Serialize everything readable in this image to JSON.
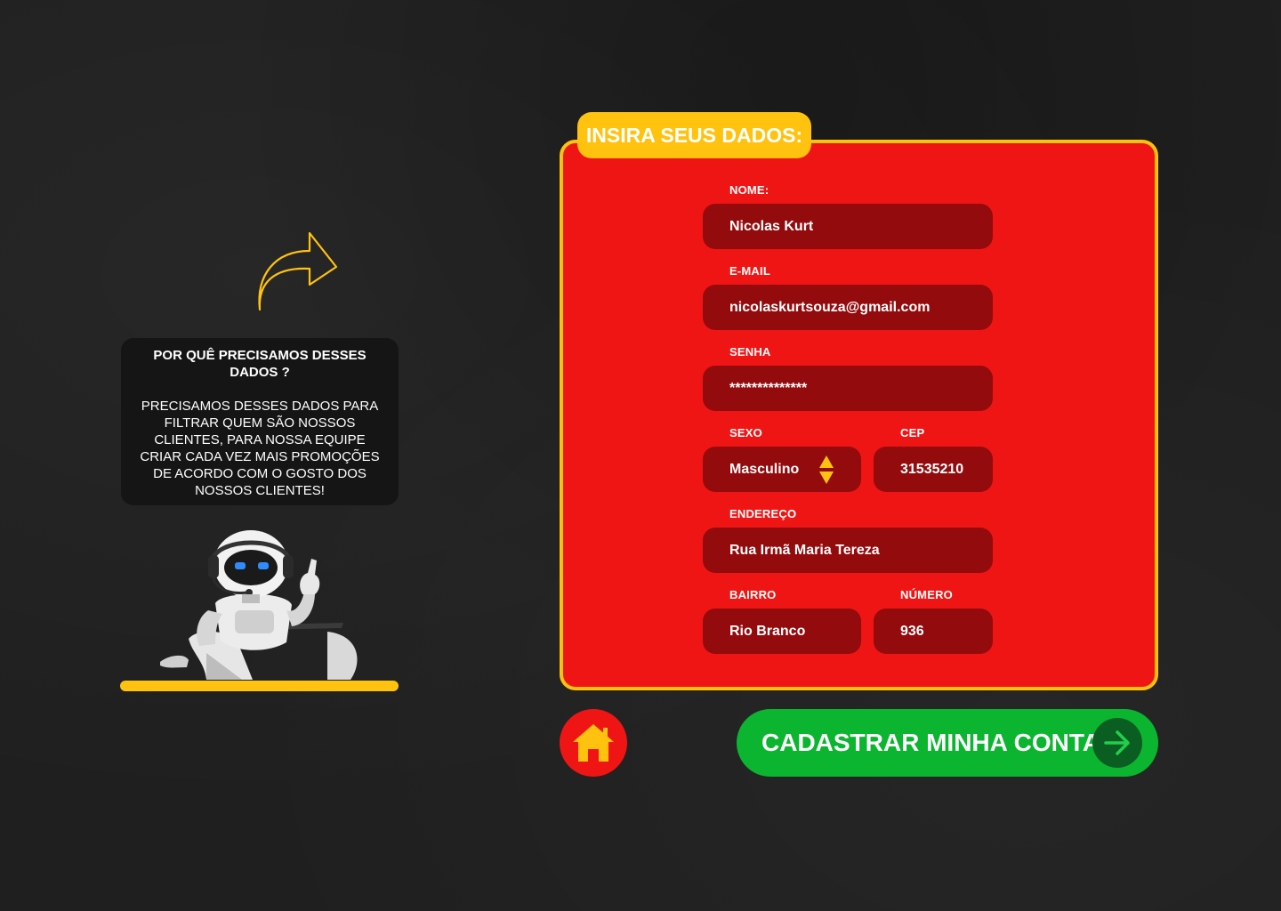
{
  "colors": {
    "background": "#1f1f1f",
    "panel_red": "#f01515",
    "field_dark_red": "#930b0d",
    "accent_yellow": "#ffc20e",
    "submit_green": "#0bb52f",
    "submit_arrow_bg": "#0b5e22"
  },
  "info": {
    "title": "POR QUÊ PRECISAMOS DESSES DADOS ?",
    "body": "PRECISAMOS DESSES DADOS PARA FILTRAR QUEM SÃO NOSSOS CLIENTES, PARA NOSSA EQUIPE CRIAR CADA VEZ MAIS PROMOÇÕES DE ACORDO COM O GOSTO DOS NOSSOS CLIENTES!",
    "arrow_icon": "curved-arrow-right-icon",
    "robot_image": "robot-with-laptop-illustration"
  },
  "form": {
    "title": "INSIRA SEUS DADOS:",
    "nome": {
      "label": "NOME:",
      "value": "Nicolas Kurt"
    },
    "email": {
      "label": "E-MAIL",
      "value": "nicolaskurtsouza@gmail.com"
    },
    "senha": {
      "label": "SENHA",
      "value": "**************"
    },
    "sexo": {
      "label": "SEXO",
      "value": "Masculino",
      "icon": "sort-up-down-icon"
    },
    "cep": {
      "label": "CEP",
      "value": "31535210"
    },
    "endereco": {
      "label": "ENDEREÇO",
      "value": "Rua Irmã Maria Tereza"
    },
    "bairro": {
      "label": "BAIRRO",
      "value": "Rio Branco"
    },
    "numero": {
      "label": "NÚMERO",
      "value": "936"
    }
  },
  "buttons": {
    "home_icon": "home-icon",
    "submit_label": "CADASTRAR MINHA CONTA",
    "submit_icon": "arrow-right-icon"
  }
}
